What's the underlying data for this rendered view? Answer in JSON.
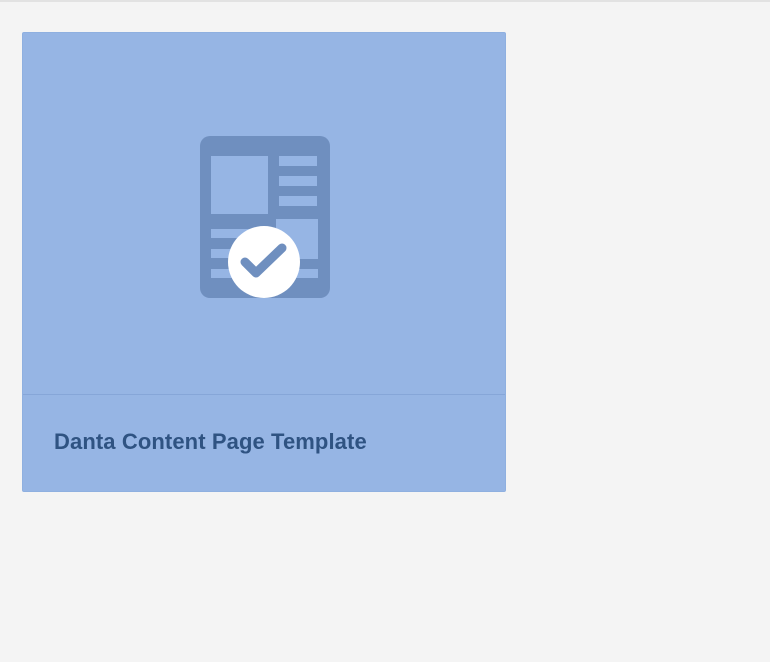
{
  "cards": [
    {
      "title": "Danta Content Page Template",
      "selected": true,
      "thumbnail_icon": "page-template-icon",
      "selection_icon": "checkmark-icon"
    }
  ],
  "colors": {
    "background": "#f4f4f4",
    "card_selected": "#96b5e4",
    "card_border": "#8fb0e0",
    "icon_fill": "#6f8fbf",
    "title_text": "#2f5382",
    "check_circle": "#ffffff",
    "check_mark": "#96b5e4"
  }
}
